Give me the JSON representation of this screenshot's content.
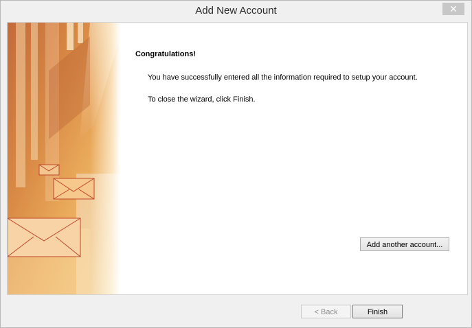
{
  "window": {
    "title": "Add New Account",
    "close_glyph": "✕"
  },
  "main": {
    "heading": "Congratulations!",
    "message_success": "You have successfully entered all the information required to setup your account.",
    "message_close": "To close the wizard, click Finish."
  },
  "buttons": {
    "add_another": "Add another account...",
    "back": "< Back",
    "finish": "Finish"
  },
  "icons": {
    "side_art": "envelopes-illustration-icon"
  }
}
